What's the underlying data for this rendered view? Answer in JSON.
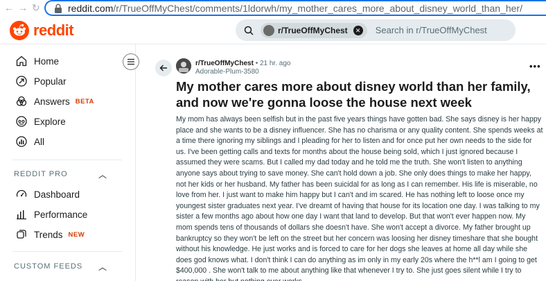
{
  "browser": {
    "url_host": "reddit.com",
    "url_path": "/r/TrueOffMyChest/comments/1ldorwh/my_mother_cares_more_about_disney_world_than_her/"
  },
  "header": {
    "logo_text": "reddit",
    "search_chip_label": "r/TrueOffMyChest",
    "search_placeholder": "Search in r/TrueOffMyChest"
  },
  "sidebar": {
    "nav": [
      {
        "label": "Home",
        "icon": "home-icon"
      },
      {
        "label": "Popular",
        "icon": "popular-icon"
      },
      {
        "label": "Answers",
        "icon": "answers-icon",
        "badge": "BETA"
      },
      {
        "label": "Explore",
        "icon": "explore-icon"
      },
      {
        "label": "All",
        "icon": "all-icon"
      }
    ],
    "reddit_pro": {
      "title": "REDDIT PRO",
      "items": [
        {
          "label": "Dashboard",
          "icon": "dashboard-icon"
        },
        {
          "label": "Performance",
          "icon": "performance-icon"
        },
        {
          "label": "Trends",
          "icon": "trends-icon",
          "badge": "NEW"
        }
      ]
    },
    "custom_feeds_title": "CUSTOM FEEDS"
  },
  "post": {
    "subreddit": "r/TrueOffMyChest",
    "time": "• 21 hr. ago",
    "author": "Adorable-Plum-3580",
    "more": "•••",
    "title": "My mother cares more about disney world than her family, and now we're gonna loose the house next week",
    "body": "My mom has always been selfish but in the past five years things have gotten bad. She says disney is her happy place and she wants to be a disney influencer. She has no charisma or any quality content. She spends weeks at a time there ignoring my siblings and I pleading for her to listen and for once put her own needs to the side for us. I've been getting calls and texts for months about the house being sold, which I just ignored because I assumed they were scams. But I called my dad today and he told me the truth. She won't listen to anything anyone says about trying to save money. She can't hold down a job. She only does things to make her happy, not her kids or her husband. My father has been suicidal for as long as I can remember. His life is miserable, no love from her. I just want to make him happy but I can't and im scared. He has nothing left to loose once my youngest sister graduates next year. I've dreamt of having that house for its location one day. I was talking to my sister a few months ago about how one day I want that land to develop. But that won't ever happen now. My mom spends tens of thousands of dollars she doesn't have. She won't accept a divorce. My father brought up bankruptcy so they won't be left on the street but her concern was loosing her disney timeshare that she bought without his knowledge. He just works and is forced to care for her dogs she leaves at home all day while she does god knows what. I don't think I can do anything as im only in my early 20s where the h**l am I going to get $400,000 . She won't talk to me about anything like that whenever I try to. She just goes silent while I try to reason with her but nothing ever works."
  }
}
